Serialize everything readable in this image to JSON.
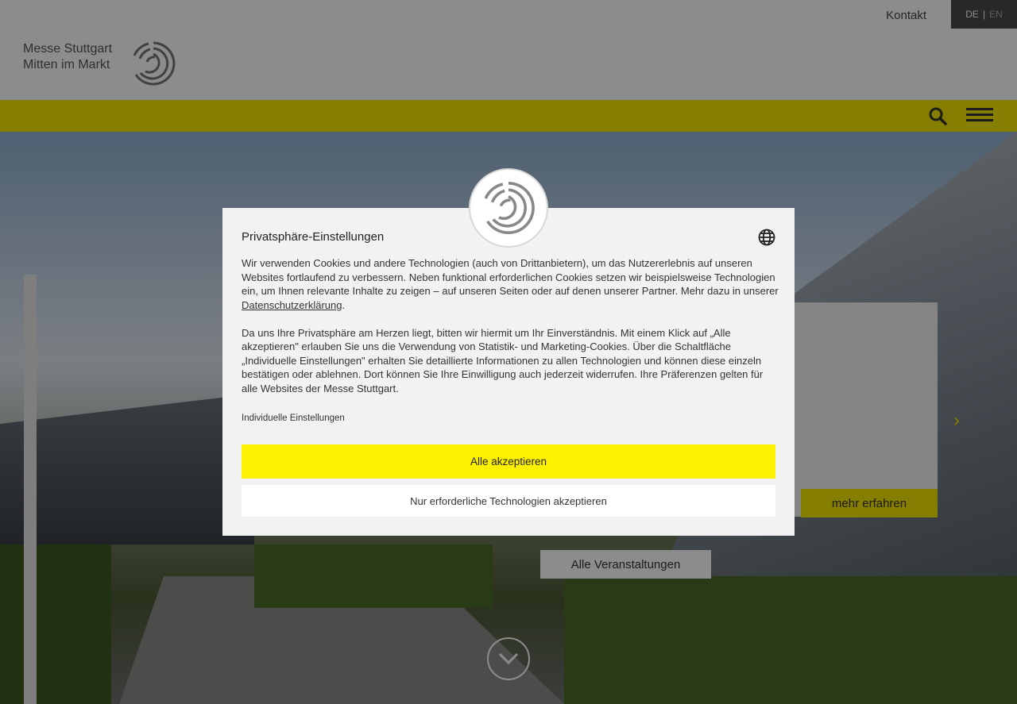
{
  "header": {
    "logo_line1": "Messe Stuttgart",
    "logo_line2": "Mitten im Markt",
    "kontakt": "Kontakt",
    "lang_de": "DE",
    "lang_sep": "|",
    "lang_en": "EN"
  },
  "navbar": {
    "color": "#f2e600",
    "search_icon": "search-icon",
    "menu_icon": "hamburger-menu-icon"
  },
  "hero": {
    "mehr_erfahren": "mehr erfahren",
    "alle_veranstaltungen": "Alle Veranstaltungen",
    "scroll_icon": "chevron-down-icon",
    "next_icon": "chevron-right-icon"
  },
  "modal": {
    "title": "Privatsphäre-Einstellungen",
    "globe_icon": "globe-icon",
    "para1_text": "Wir verwenden Cookies und andere Technologien (auch von Drittanbietern), um das Nutzererlebnis auf unseren Websites fortlaufend zu verbessern. Neben funktional erforderlichen Cookies setzen wir beispielsweise Technologien ein, um Ihnen relevante Inhalte zu zeigen – auf unseren Seiten oder auf denen unserer Partner. Mehr dazu in unserer ",
    "para1_link": "Datenschutzerklärung",
    "para1_end": ".",
    "para2_text": "Da uns Ihre Privatsphäre am Herzen liegt, bitten wir hiermit um Ihr Einverständnis. Mit einem Klick auf „Alle akzeptieren\" erlauben Sie uns die Verwendung von Statistik- und Marketing-Cookies. Über die Schaltfläche „Individuelle Einstellungen\" erhalten Sie detaillierte Informationen zu allen Technologien und können diese einzeln bestätigen oder ablehnen. Dort können Sie Ihre Einwilligung auch jederzeit widerrufen. Ihre Präferenzen gelten für alle Websites der Messe Stuttgart.",
    "individual_settings": "Individuelle Einstellungen",
    "accept_all": "Alle akzeptieren",
    "accept_required": "Nur erforderliche Technologien akzeptieren",
    "accept_color": "#fff200"
  }
}
